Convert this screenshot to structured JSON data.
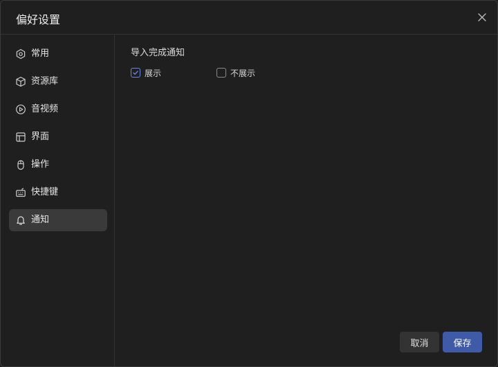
{
  "dialog": {
    "title": "偏好设置"
  },
  "sidebar": {
    "items": [
      {
        "label": "常用",
        "icon": "general-icon",
        "active": false
      },
      {
        "label": "资源库",
        "icon": "cube-icon",
        "active": false
      },
      {
        "label": "音视频",
        "icon": "play-icon",
        "active": false
      },
      {
        "label": "界面",
        "icon": "layout-icon",
        "active": false
      },
      {
        "label": "操作",
        "icon": "mouse-icon",
        "active": false
      },
      {
        "label": "快捷键",
        "icon": "keyboard-icon",
        "active": false
      },
      {
        "label": "通知",
        "icon": "bell-icon",
        "active": true
      }
    ]
  },
  "notification": {
    "section_title": "导入完成通知",
    "options": [
      {
        "label": "展示",
        "checked": true
      },
      {
        "label": "不展示",
        "checked": false
      }
    ]
  },
  "footer": {
    "cancel_label": "取消",
    "save_label": "保存"
  },
  "colors": {
    "accent": "#3f5aa6",
    "check": "#6b86e6",
    "active_bg": "#3a3a3a"
  }
}
